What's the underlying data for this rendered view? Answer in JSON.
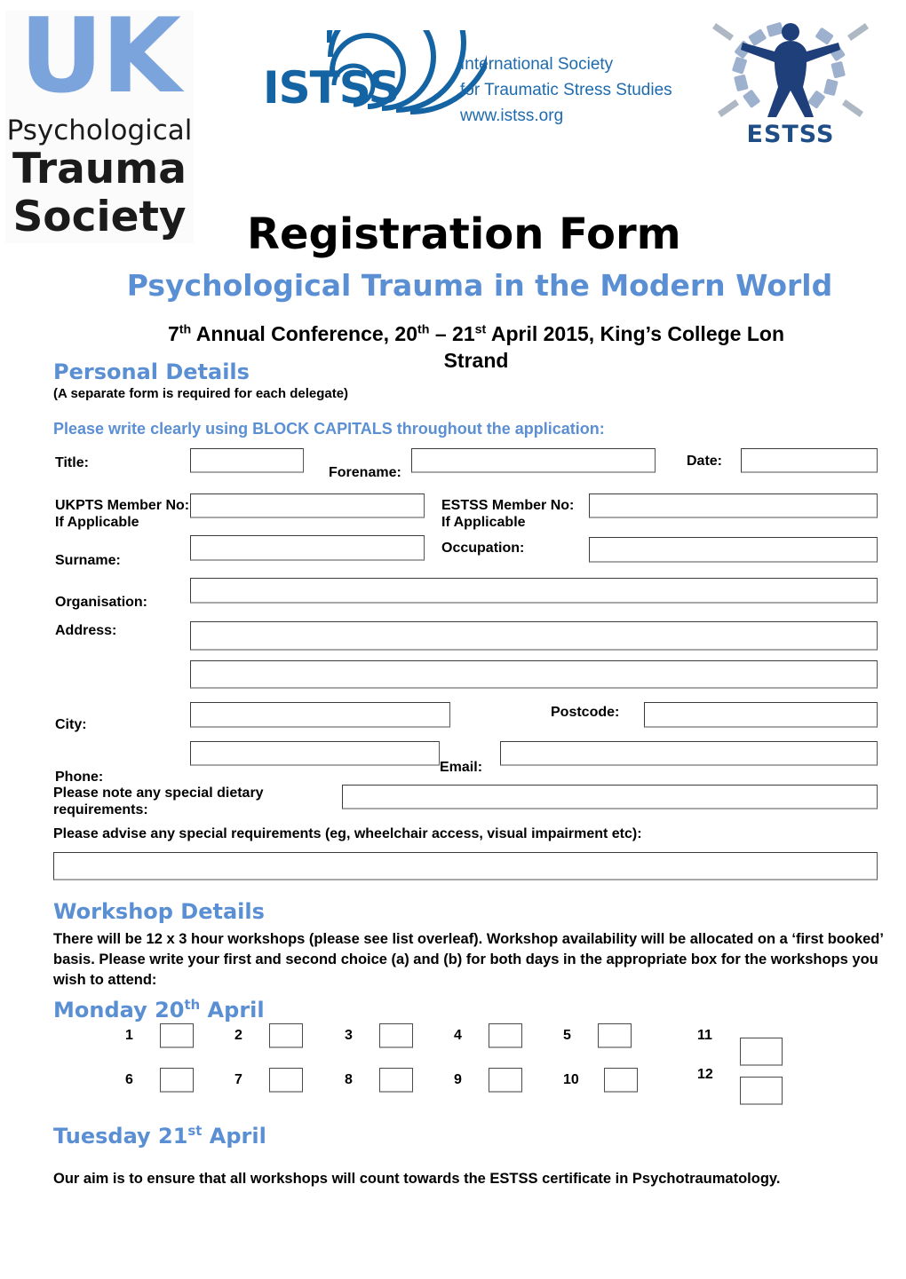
{
  "logos": {
    "ukpts": {
      "name": "uk-psychological-trauma-society-logo",
      "uk": "UK",
      "psychological": "Psychological",
      "trauma": "Trauma",
      "society": "Society"
    },
    "istss": {
      "name": "istss-logo",
      "acronym": "ISTSS",
      "line1": "International Society",
      "line2": "for Traumatic Stress Studies",
      "line3": "www.istss.org"
    },
    "estss": {
      "name": "estss-logo",
      "acronym": "ESTSS"
    }
  },
  "header": {
    "title": "Registration Form",
    "subtitle": "Psychological Trauma in the Modern World",
    "conference_line": "7th Annual Conference, 20th – 21st April 2015, King’s College Lon",
    "venue_line": "Strand"
  },
  "personal": {
    "heading": "Personal Details",
    "delegate_note": "(A separate form is required for each delegate)",
    "block_capitals_note": "Please write clearly using BLOCK CAPITALS throughout the application:",
    "labels": {
      "title": "Title:",
      "forename": "Forename:",
      "date": "Date:",
      "ukpts_member": "UKPTS Member No:",
      "ukpts_member_2": "If Applicable",
      "estss_member": "ESTSS Member No:",
      "estss_member_2": "If Applicable",
      "surname": "Surname:",
      "occupation": "Occupation:",
      "organisation": "Organisation:",
      "address": "Address:",
      "city": "City:",
      "postcode": "Postcode:",
      "phone": "Phone:",
      "email": "Email:",
      "dietary": "Please note any special dietary requirements:",
      "special_requirements": "Please advise any special requirements (eg, wheelchair access, visual impairment etc):"
    },
    "values": {
      "title": "",
      "forename": "",
      "date": "",
      "ukpts_member": "",
      "estss_member": "",
      "surname": "",
      "occupation": "",
      "organisation": "",
      "address1": "",
      "address2": "",
      "city": "",
      "postcode": "",
      "phone": "",
      "email": "",
      "dietary": "",
      "special_requirements": ""
    }
  },
  "workshop": {
    "heading": "Workshop Details",
    "intro": "There will be 12 x 3 hour workshops (please see list overleaf).   Workshop availability will be allocated on a ‘first booked’ basis.  Please write your first and second choice (a) and (b) for both days in the appropriate box for the workshops you wish to attend:",
    "monday_heading": "Monday 20th April",
    "tuesday_heading": "Tuesday 21st April",
    "numbers_row1": [
      "1",
      "2",
      "3",
      "4",
      "5"
    ],
    "numbers_row2": [
      "6",
      "7",
      "8",
      "9",
      "10"
    ],
    "numbers_side": [
      "11",
      "12"
    ],
    "values_row1": [
      "",
      "",
      "",
      "",
      ""
    ],
    "values_row2": [
      "",
      "",
      "",
      "",
      ""
    ],
    "values_side": [
      "",
      ""
    ],
    "aim_text": "Our aim is to ensure that all workshops will count towards the ESTSS certificate in Psychotraumatology."
  },
  "colors": {
    "accent_blue": "#5B8FD4",
    "logo_blue": "#7BA4DC",
    "istss_blue": "#1463A3",
    "estss_navy": "#1F4E87",
    "text_black": "#000000",
    "box_border": "#3a3a3a"
  }
}
